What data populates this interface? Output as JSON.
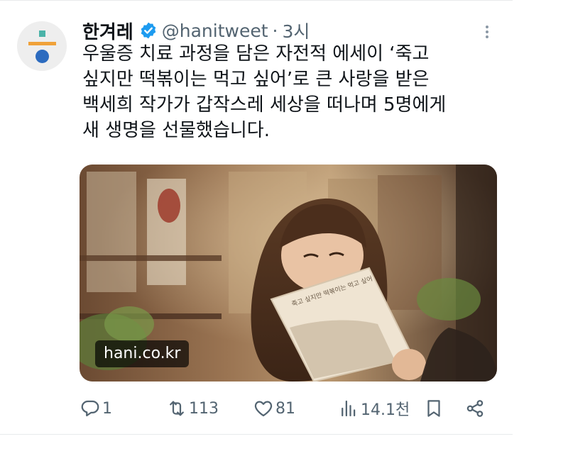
{
  "tweet": {
    "author_name": "한겨레",
    "handle": "@hanitweet",
    "separator": "·",
    "time": "3시",
    "text_lines": [
      "우울증 치료 과정을 담은 자전적 에세이 ‘죽고",
      "싶지만 떡볶이는 먹고 싶어’로 큰 사랑을 받은",
      "백세희 작가가 갑작스레 세상을 떠나며 5명에게",
      "새 생명을 선물했습니다."
    ],
    "link_domain": "hani.co.kr",
    "book_cover_text": "죽고 싶지만 떡볶이는 먹고 싶어"
  },
  "actions": {
    "reply_count": "1",
    "retweet_count": "113",
    "like_count": "81",
    "view_count": "14.1천"
  },
  "colors": {
    "verified_blue": "#1d9bf0",
    "secondary_text": "#536471",
    "primary_text": "#0f1419"
  },
  "icons": [
    "verified-badge-icon",
    "more-icon",
    "reply-icon",
    "retweet-icon",
    "like-icon",
    "views-icon",
    "bookmark-icon",
    "share-icon"
  ]
}
